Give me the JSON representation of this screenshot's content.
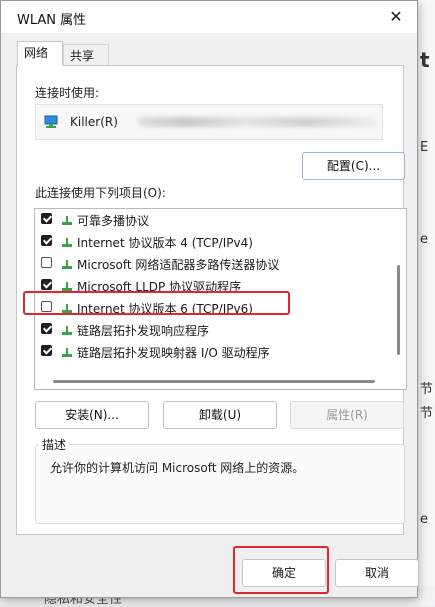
{
  "background": {
    "right_chars": [
      "t",
      "E",
      "e",
      "节",
      "节",
      "e"
    ],
    "bottom_text": "隐私和安全性"
  },
  "dialog": {
    "title": "WLAN 属性",
    "close_glyph": "✕",
    "tabs": [
      {
        "label": "网络",
        "active": true
      },
      {
        "label": "共享",
        "active": false
      }
    ],
    "connect_using_label": "连接时使用:",
    "adapter_name": "Killer(R)",
    "configure_label": "配置(C)...",
    "items_label": "此连接使用下列项目(O):",
    "items": [
      {
        "label": "可靠多播协议",
        "checked": true
      },
      {
        "label": "Internet 协议版本 4 (TCP/IPv4)",
        "checked": true
      },
      {
        "label": "Microsoft 网络适配器多路传送器协议",
        "checked": false
      },
      {
        "label": "Microsoft LLDP 协议驱动程序",
        "checked": true
      },
      {
        "label": "Internet 协议版本 6 (TCP/IPv6)",
        "checked": false
      },
      {
        "label": "链路层拓扑发现响应程序",
        "checked": true
      },
      {
        "label": "链路层拓扑发现映射器 I/O 驱动程序",
        "checked": true
      }
    ],
    "install_label": "安装(N)...",
    "uninstall_label": "卸载(U)",
    "properties_label": "属性(R)",
    "description_title": "描述",
    "description_text": "允许你的计算机访问 Microsoft 网络上的资源。",
    "ok_label": "确定",
    "cancel_label": "取消"
  },
  "colors": {
    "highlight": "#e0262f",
    "accent": "#0a5cbf"
  }
}
